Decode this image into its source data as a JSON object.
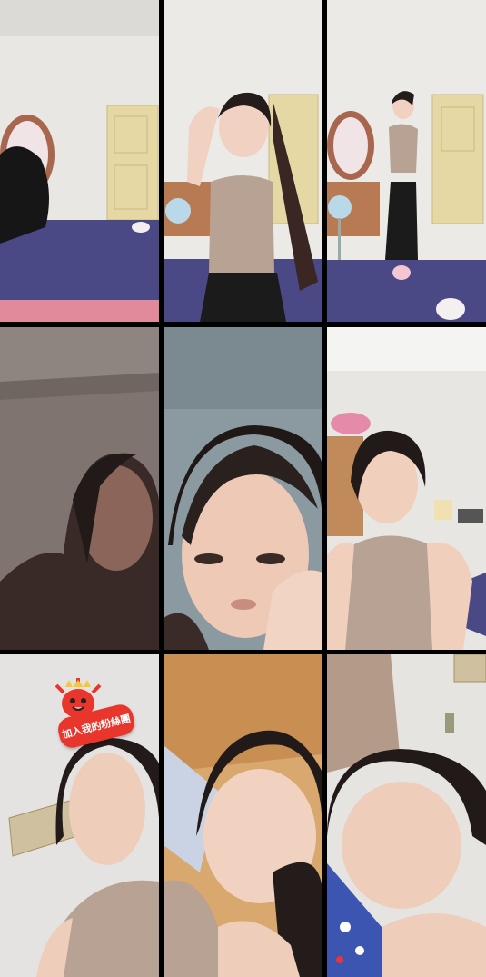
{
  "colors": {
    "wall": "#ecebe8",
    "bedspread": "#4b4a86",
    "door": "#e9dca9",
    "top": "#b7a294",
    "hair": "#1e1a19",
    "badge": "#e8362d"
  },
  "tiles": [
    {
      "id": "tile-1",
      "scene": "bedroom-bed"
    },
    {
      "id": "tile-2",
      "scene": "posing-beige-top"
    },
    {
      "id": "tile-3",
      "scene": "standing-full-body"
    },
    {
      "id": "tile-4",
      "scene": "dim-room-profile"
    },
    {
      "id": "tile-5",
      "scene": "face-closeup-dark"
    },
    {
      "id": "tile-6",
      "scene": "sitting-closeup"
    },
    {
      "id": "tile-7",
      "scene": "lying-with-badge"
    },
    {
      "id": "tile-8",
      "scene": "lying-wood-headboard"
    },
    {
      "id": "tile-9",
      "scene": "sleeping-blue-pillow"
    }
  ],
  "fan_club_badge": {
    "text": "加入我的粉絲團",
    "icon": "heart-mascot-icon"
  }
}
